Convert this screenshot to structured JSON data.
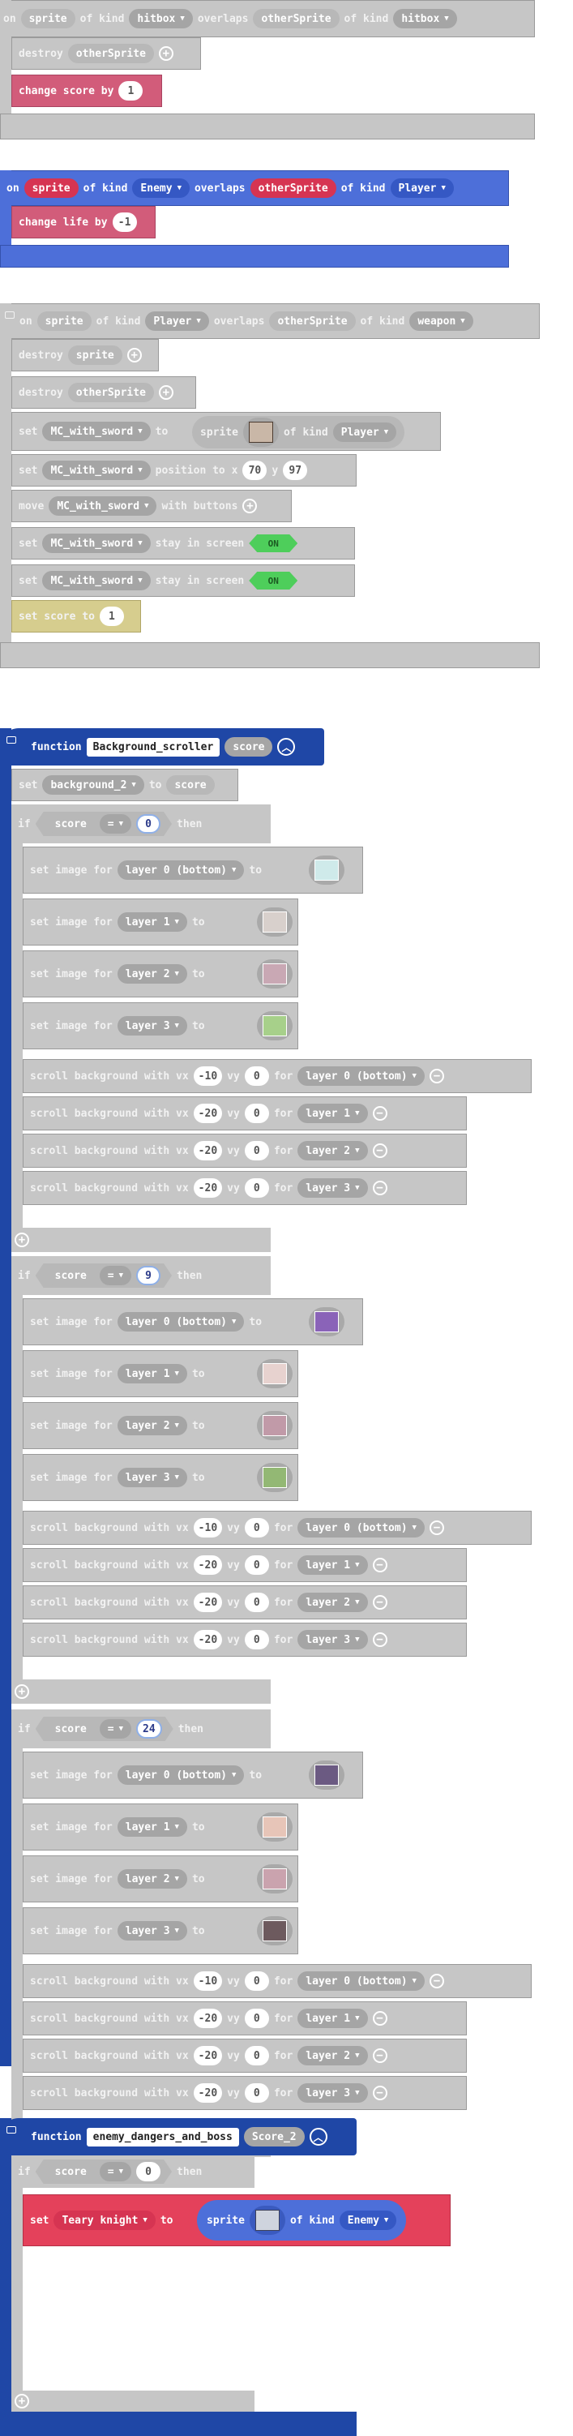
{
  "colors": {
    "gray_block": "#c6c6c6",
    "gray_dark": "#a5a5a5",
    "info_red": "#d25c7a",
    "enemy_red": "#e4415b",
    "event_blue": "#4d6fd9",
    "function_blue": "#1f47a6",
    "toggle_green": "#4ece5b"
  },
  "kw": {
    "on": "on",
    "of_kind": "of kind",
    "overlaps": "overlaps",
    "destroy": "destroy",
    "change_score_by": "change score by",
    "change_life_by": "change life by",
    "set": "set",
    "to": "to",
    "position_to_x": "position to x",
    "y": "y",
    "move": "move",
    "with_buttons": "with buttons",
    "stay_in_screen": "stay in screen",
    "on_toggle": "ON",
    "set_score_to": "set score to",
    "function": "function",
    "if": "if",
    "then": "then",
    "set_image_for": "set image for",
    "scroll_background_with_vx": "scroll background with vx",
    "vy": "vy",
    "for": "for",
    "eq": "=",
    "sprite": "sprite"
  },
  "event1": {
    "sprite": "sprite",
    "kind1": "hitbox",
    "other": "otherSprite",
    "kind2": "hitbox",
    "destroy_target": "otherSprite",
    "score_value": "1"
  },
  "event2": {
    "sprite": "sprite",
    "kind1": "Enemy",
    "other": "otherSprite",
    "kind2": "Player",
    "life_value": "-1"
  },
  "event3": {
    "sprite": "sprite",
    "kind1": "Player",
    "other": "otherSprite",
    "kind2": "weapon",
    "destroy1": "sprite",
    "destroy2": "otherSprite",
    "var": "MC_with_sword",
    "sprite_kind": "Player",
    "pos_x": "70",
    "pos_y": "97",
    "score_value": "1"
  },
  "func1": {
    "name": "Background_scroller",
    "param": "score",
    "set_var": "background_2",
    "set_to": "score",
    "cond_var": "score",
    "layers": [
      "layer 0 (bottom)",
      "layer 1",
      "layer 2",
      "layer 3"
    ],
    "branches": [
      {
        "value": "0",
        "vx": [
          "-10",
          "-20",
          "-20",
          "-20"
        ],
        "vy": [
          "0",
          "0",
          "0",
          "0"
        ]
      },
      {
        "value": "9",
        "vx": [
          "-10",
          "-20",
          "-20",
          "-20"
        ],
        "vy": [
          "0",
          "0",
          "0",
          "0"
        ]
      },
      {
        "value": "24",
        "vx": [
          "-10",
          "-20",
          "-20",
          "-20"
        ],
        "vy": [
          "0",
          "0",
          "0",
          "0"
        ]
      }
    ]
  },
  "func2": {
    "name": "enemy_dangers_and_boss",
    "param": "Score_2",
    "cond_var": "score",
    "cond_value": "0",
    "set_var": "Teary knight",
    "sprite_kind": "Enemy"
  }
}
